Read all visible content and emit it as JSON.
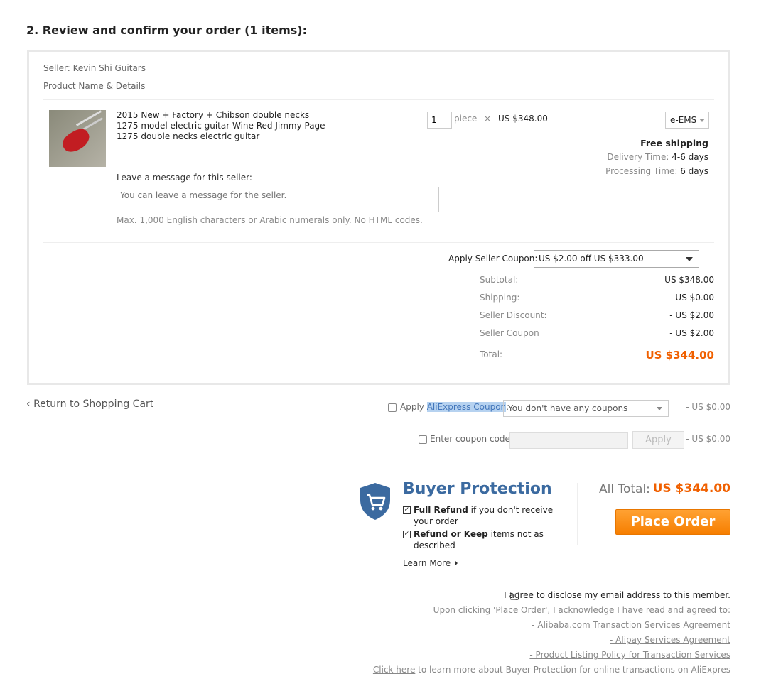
{
  "section_title": "2. Review and confirm your order (1 items):",
  "seller": "Seller: Kevin Shi Guitars",
  "product_header": "Product Name & Details",
  "product": {
    "title": "2015 New + Factory + Chibson double necks 1275 model electric guitar Wine Red Jimmy Page 1275 double necks electric guitar",
    "quantity": "1",
    "unit": "piece",
    "times": "×",
    "unit_price": "US $348.00",
    "shipping_method": "e-EMS",
    "free_shipping": "Free shipping",
    "delivery_label": "Delivery Time:",
    "delivery_value": "4-6 days",
    "processing_label": "Processing Time:",
    "processing_value": "6 days"
  },
  "message": {
    "label": "Leave a message for this seller:",
    "placeholder": "You can leave a message for the seller.",
    "hint": "Max. 1,000 English characters or Arabic numerals only. No HTML codes."
  },
  "seller_coupon": {
    "label": "Apply Seller Coupon:",
    "selected": "US $2.00 off US $333.00"
  },
  "summary": {
    "subtotal_label": "Subtotal:",
    "subtotal": "US $348.00",
    "shipping_label": "Shipping:",
    "shipping": "US $0.00",
    "seller_discount_label": "Seller Discount:",
    "seller_discount": "- US $2.00",
    "seller_coupon_label": "Seller Coupon",
    "seller_coupon": "- US $2.00",
    "total_label": "Total:",
    "total": "US $344.00"
  },
  "back_link": "Return to Shopping Cart",
  "aliexpress_coupon": {
    "apply": "Apply ",
    "name": "AliExpress Coupon",
    "colon": ":",
    "selected": "You don't have any coupons",
    "discount": "- US $0.00"
  },
  "coupon_code": {
    "label": "Enter coupon code:",
    "apply": "Apply",
    "discount": "- US $0.00"
  },
  "buyer_protection": {
    "title": "Buyer Protection",
    "item1_bold": "Full Refund",
    "item1_rest": " if you don't receive your order",
    "item2_bold": "Refund or Keep",
    "item2_rest": " items not as described",
    "learn_more": "Learn More"
  },
  "all_total_label": "All Total:",
  "all_total": "US $344.00",
  "place_order": "Place Order",
  "agree": "I agree to disclose my email address to this member.",
  "acknowledge": "Upon clicking 'Place Order', I acknowledge I have read and agreed to:",
  "terms": [
    "- Alibaba.com Transaction Services Agreement",
    "- Alipay Services Agreement",
    "- Product Listing Policy for Transaction Services"
  ],
  "click_here": "Click here",
  "click_here_rest": " to learn more about Buyer Protection for online transactions on AliExpres",
  "colors": {
    "accent_orange": "#f67e00",
    "protection_blue": "#3b6aa0"
  },
  "icons": [
    "chevron-left-icon",
    "shopping-cart-shield-icon",
    "checkbox-icon",
    "caret-right-icon",
    "dropdown-arrow-icon"
  ]
}
